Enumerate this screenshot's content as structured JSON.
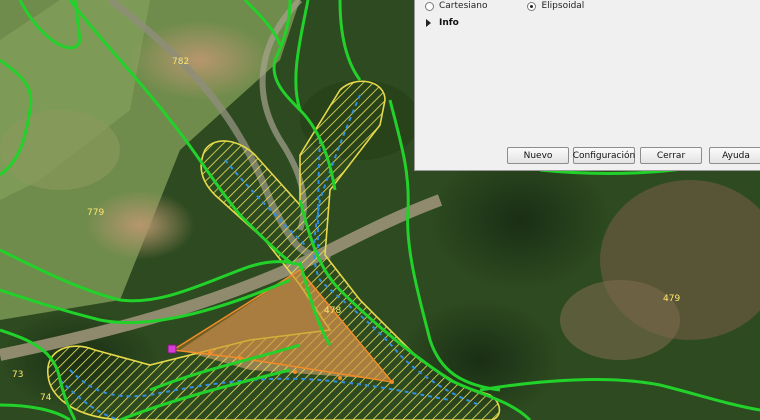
{
  "dialog": {
    "coordinate_options": [
      {
        "label": "Cartesiano",
        "selected": false
      },
      {
        "label": "Elipsoidal",
        "selected": true
      }
    ],
    "info_label": "Info",
    "buttons": {
      "nuevo": "Nuevo",
      "configuracion": "Configuración",
      "cerrar": "Cerrar",
      "ayuda": "Ayuda"
    }
  },
  "map": {
    "parcel_labels": {
      "p782": "782",
      "p779": "779",
      "p478": "478",
      "p479": "479",
      "p73": "73",
      "p74": "74"
    },
    "colors": {
      "parcel_boundary": "#22d12a",
      "buffer_outline": "#e6d94a",
      "buffer_hatch": "#f0e45a",
      "stream": "#2f8fe0",
      "measured_polygon": "#f28c28",
      "vertex_marker": "#d63cd6",
      "label_text": "#ffe66b"
    }
  }
}
